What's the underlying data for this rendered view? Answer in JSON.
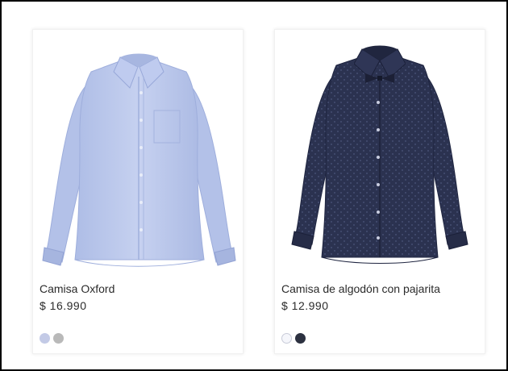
{
  "products": [
    {
      "name": "Camisa Oxford",
      "price": "$ 16.990",
      "swatches": [
        {
          "color": "#c3cae6",
          "label": "light blue"
        },
        {
          "color": "#b9b9b9",
          "label": "grey"
        }
      ]
    },
    {
      "name": "Camisa de algodón con pajarita",
      "price": "$ 12.990",
      "swatches": [
        {
          "color": "#f5f6fb",
          "label": "white"
        },
        {
          "color": "#2c3140",
          "label": "dark blue"
        }
      ]
    }
  ],
  "colors": {
    "frame_border": "#000000",
    "text": "#2b2b2b",
    "oxford_shirt": "#b7c5ea",
    "navy_shirt": "#2b3250"
  }
}
